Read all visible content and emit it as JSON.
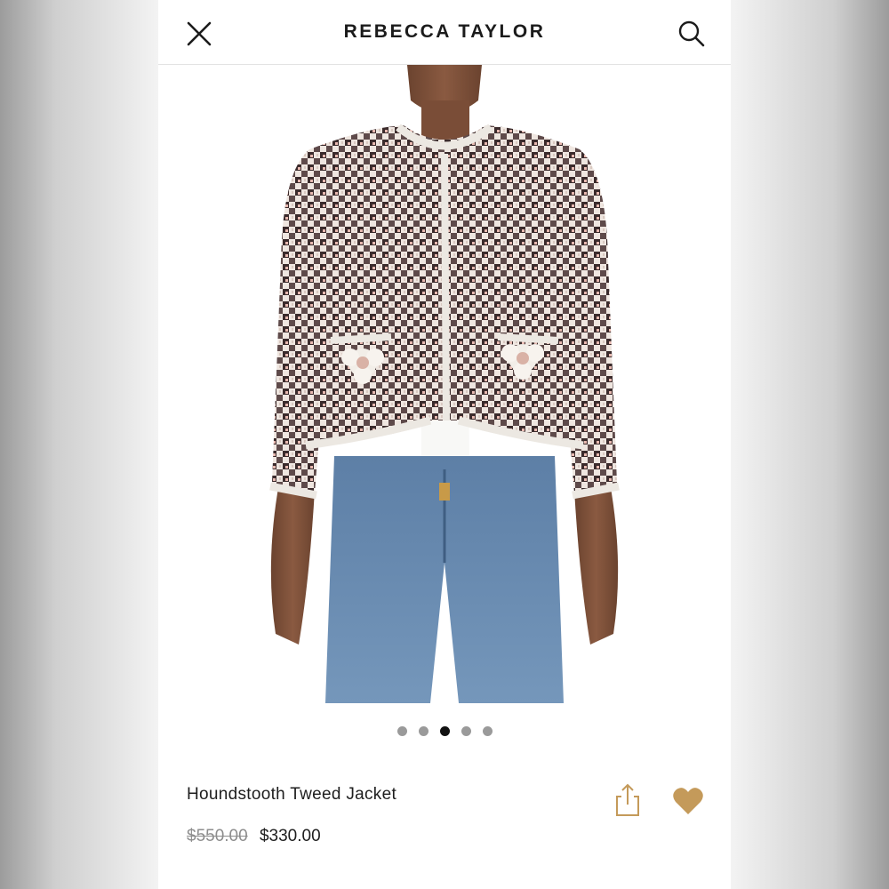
{
  "header": {
    "brand": "REBECCA TAYLOR",
    "close_icon": "close-icon",
    "search_icon": "search-icon"
  },
  "product": {
    "name": "Houndstooth Tweed Jacket",
    "original_price": "$550.00",
    "sale_price": "$330.00",
    "image": "model wearing black and white tweed jacket with floral pocket appliques over white top and blue jeans"
  },
  "carousel": {
    "total": 5,
    "active_index": 2
  },
  "actions": {
    "share_icon": "share-icon",
    "wishlist_icon": "heart-icon"
  },
  "colors": {
    "heart": "#c49a5a",
    "share": "#c49a5a",
    "text": "#1e1e1e",
    "strike": "#8d8d8d"
  }
}
